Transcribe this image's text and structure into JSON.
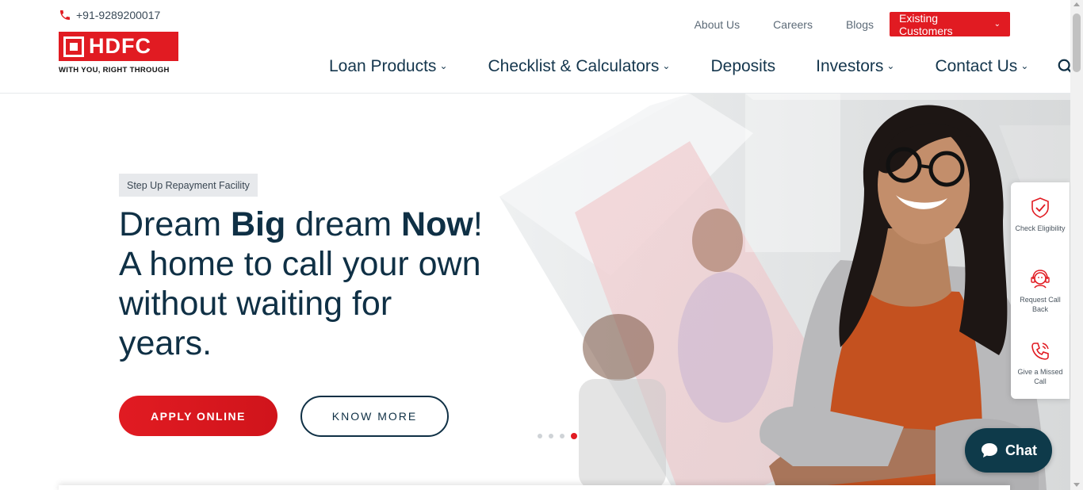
{
  "header": {
    "phone": "+91-9289200017",
    "logo_text": "HDFC",
    "logo_tagline": "WITH YOU, RIGHT THROUGH",
    "top_links": [
      {
        "label": "About Us"
      },
      {
        "label": "Careers"
      },
      {
        "label": "Blogs"
      }
    ],
    "existing_customers_label": "Existing Customers",
    "nav": [
      {
        "label": "Loan Products",
        "has_dropdown": true
      },
      {
        "label": "Checklist & Calculators",
        "has_dropdown": true
      },
      {
        "label": "Deposits",
        "has_dropdown": false
      },
      {
        "label": "Investors",
        "has_dropdown": true
      },
      {
        "label": "Contact Us",
        "has_dropdown": true
      }
    ]
  },
  "hero": {
    "badge": "Step Up Repayment Facility",
    "headline_part1": "Dream ",
    "headline_bold1": "Big",
    "headline_part2": " dream ",
    "headline_bold2": "Now",
    "headline_part3": "!",
    "headline_line2": "A home to call your own without waiting for years.",
    "apply_label": "APPLY ONLINE",
    "know_more_label": "KNOW MORE",
    "carousel_slides": 4,
    "carousel_active_index": 3
  },
  "side_panel": [
    {
      "label": "Check Eligibility",
      "icon": "shield-check-icon"
    },
    {
      "label": "Request Call Back",
      "icon": "support-agent-icon"
    },
    {
      "label": "Give a Missed Call",
      "icon": "phone-ringing-icon"
    }
  ],
  "chat": {
    "label": "Chat"
  },
  "colors": {
    "brand_red": "#e11b22",
    "navy": "#0f3045",
    "chat_bg": "#0e3a4a"
  }
}
